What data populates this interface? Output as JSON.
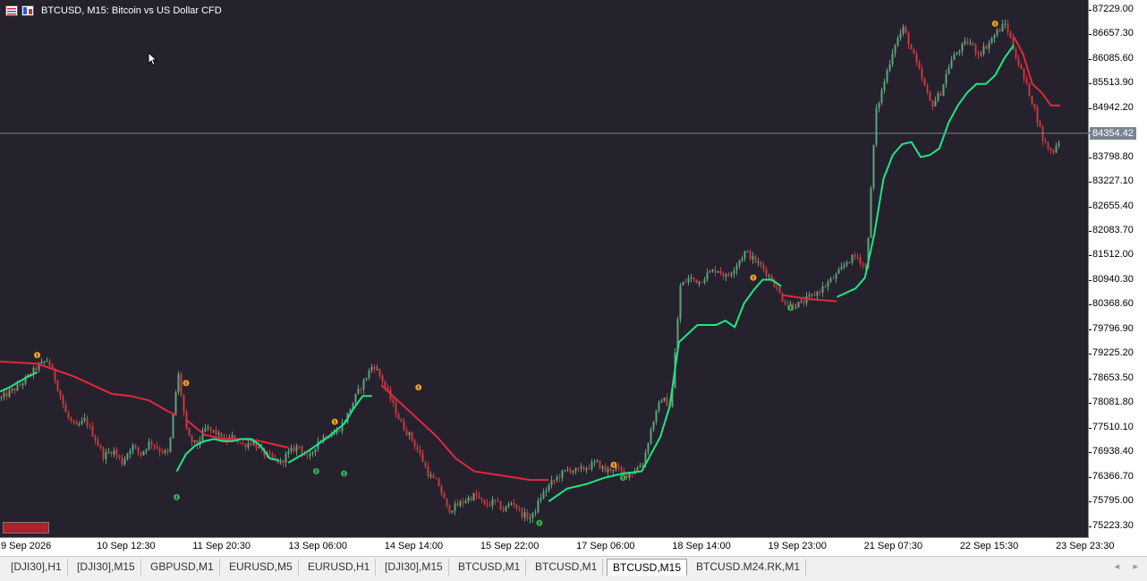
{
  "title": {
    "symbol": "BTCUSD, M15:",
    "description": "Bitcoin vs US Dollar CFD"
  },
  "icons": [
    "candles-grid-icon",
    "one-click-trading-icon"
  ],
  "price_axis": {
    "ticks": [
      "87229.00",
      "86657.30",
      "86085.60",
      "85513.90",
      "84942.20",
      "84370.50",
      "83798.80",
      "83227.10",
      "82655.40",
      "82083.70",
      "81512.00",
      "80940.30",
      "80368.60",
      "79796.90",
      "79225.20",
      "78653.50",
      "78081.80",
      "77510.10",
      "76938.40",
      "76366.70",
      "75795.00",
      "75223.30"
    ],
    "current_price": "84354.42"
  },
  "time_axis": {
    "labels": [
      "9 Sep 2026",
      "10 Sep 12:30",
      "11 Sep 20:30",
      "13 Sep 06:00",
      "14 Sep 14:00",
      "15 Sep 22:00",
      "17 Sep 06:00",
      "18 Sep 14:00",
      "19 Sep 23:00",
      "21 Sep 07:30",
      "22 Sep 15:30",
      "23 Sep 23:30"
    ]
  },
  "tabs": [
    {
      "label": "[DJI30],H1",
      "active": false
    },
    {
      "label": "[DJI30],M15",
      "active": false
    },
    {
      "label": "GBPUSD,M1",
      "active": false
    },
    {
      "label": "EURUSD,M5",
      "active": false
    },
    {
      "label": "EURUSD,H1",
      "active": false
    },
    {
      "label": "[DJI30],M15",
      "active": false
    },
    {
      "label": "BTCUSD,M1",
      "active": false
    },
    {
      "label": "BTCUSD,M1",
      "active": false
    },
    {
      "label": "BTCUSD,M15",
      "active": true
    },
    {
      "label": "BTCUSD.M24.RK,M1",
      "active": false
    }
  ],
  "tab_scroll": {
    "left": "◂",
    "right": "▸"
  },
  "colors": {
    "background": "#25222d",
    "bull_candle": "#5fa37a",
    "bear_candle": "#c9383f",
    "supertrend_up": "#1de782",
    "supertrend_down": "#e3283b",
    "sell_arrow": "#f0a020",
    "buy_arrow": "#2fae4f",
    "price_line": "#7a8491"
  },
  "chart_data": {
    "type": "candlestick",
    "symbol": "BTCUSD",
    "timeframe": "M15",
    "ylim": [
      74950,
      87450
    ],
    "close_path": [
      [
        0,
        78200
      ],
      [
        2,
        78500
      ],
      [
        4,
        78950
      ],
      [
        5,
        79100
      ],
      [
        6,
        78500
      ],
      [
        7,
        77800
      ],
      [
        8,
        77500
      ],
      [
        9,
        77700
      ],
      [
        10,
        77300
      ],
      [
        11,
        76850
      ],
      [
        12,
        77000
      ],
      [
        13,
        76700
      ],
      [
        14,
        77100
      ],
      [
        15,
        76900
      ],
      [
        16,
        77200
      ],
      [
        17,
        77000
      ],
      [
        18,
        76900
      ],
      [
        19,
        78800
      ],
      [
        20,
        77300
      ],
      [
        21,
        77100
      ],
      [
        22,
        77500
      ],
      [
        23,
        77400
      ],
      [
        24,
        77200
      ],
      [
        25,
        77300
      ],
      [
        26,
        77100
      ],
      [
        27,
        77200
      ],
      [
        28,
        76950
      ],
      [
        29,
        76800
      ],
      [
        30,
        76700
      ],
      [
        31,
        76950
      ],
      [
        32,
        77100
      ],
      [
        33,
        76750
      ],
      [
        34,
        77200
      ],
      [
        35,
        77350
      ],
      [
        36,
        77400
      ],
      [
        37,
        77700
      ],
      [
        38,
        78200
      ],
      [
        39,
        78600
      ],
      [
        40,
        79000
      ],
      [
        41,
        78600
      ],
      [
        42,
        78100
      ],
      [
        43,
        77600
      ],
      [
        44,
        77300
      ],
      [
        45,
        76900
      ],
      [
        46,
        76400
      ],
      [
        47,
        76200
      ],
      [
        48,
        75600
      ],
      [
        49,
        75700
      ],
      [
        50,
        75850
      ],
      [
        51,
        75950
      ],
      [
        52,
        75700
      ],
      [
        53,
        75800
      ],
      [
        54,
        75600
      ],
      [
        55,
        75800
      ],
      [
        56,
        75500
      ],
      [
        57,
        75400
      ],
      [
        58,
        75900
      ],
      [
        59,
        76200
      ],
      [
        60,
        76400
      ],
      [
        61,
        76550
      ],
      [
        62,
        76500
      ],
      [
        63,
        76600
      ],
      [
        64,
        76700
      ],
      [
        65,
        76500
      ],
      [
        66,
        76600
      ],
      [
        67,
        76400
      ],
      [
        68,
        76500
      ],
      [
        69,
        76700
      ],
      [
        70,
        77600
      ],
      [
        71,
        78200
      ],
      [
        72,
        78000
      ],
      [
        73,
        80800
      ],
      [
        74,
        81000
      ],
      [
        75,
        80900
      ],
      [
        76,
        81100
      ],
      [
        77,
        81200
      ],
      [
        78,
        81000
      ],
      [
        79,
        81300
      ],
      [
        80,
        81600
      ],
      [
        81,
        81400
      ],
      [
        82,
        81200
      ],
      [
        83,
        80900
      ],
      [
        84,
        80500
      ],
      [
        85,
        80350
      ],
      [
        86,
        80400
      ],
      [
        87,
        80550
      ],
      [
        88,
        80700
      ],
      [
        89,
        80900
      ],
      [
        90,
        81100
      ],
      [
        91,
        81400
      ],
      [
        92,
        81500
      ],
      [
        93,
        81200
      ],
      [
        94,
        84800
      ],
      [
        95,
        85600
      ],
      [
        96,
        86400
      ],
      [
        97,
        86800
      ],
      [
        98,
        86200
      ],
      [
        99,
        85600
      ],
      [
        100,
        85000
      ],
      [
        101,
        85300
      ],
      [
        102,
        86000
      ],
      [
        103,
        86300
      ],
      [
        104,
        86500
      ],
      [
        105,
        86200
      ],
      [
        106,
        86400
      ],
      [
        107,
        86700
      ],
      [
        108,
        86900
      ],
      [
        109,
        86200
      ],
      [
        110,
        85600
      ],
      [
        111,
        85000
      ],
      [
        112,
        84200
      ],
      [
        113,
        83900
      ],
      [
        114,
        84300
      ]
    ],
    "series": [
      {
        "name": "",
        "values": []
      }
    ],
    "supertrend": {
      "down_segments": [
        [
          [
            0,
            79050
          ],
          [
            4,
            79000
          ],
          [
            8,
            78700
          ],
          [
            10,
            78500
          ],
          [
            12,
            78300
          ],
          [
            14,
            78250
          ],
          [
            16,
            78150
          ],
          [
            18,
            77900
          ],
          [
            19,
            77800
          ]
        ],
        [
          [
            20,
            77700
          ],
          [
            22,
            77350
          ],
          [
            24,
            77250
          ],
          [
            26,
            77250
          ],
          [
            28,
            77200
          ],
          [
            30,
            77100
          ],
          [
            31,
            77050
          ]
        ],
        [
          [
            41,
            78500
          ],
          [
            43,
            78100
          ],
          [
            45,
            77700
          ],
          [
            47,
            77300
          ],
          [
            49,
            76800
          ],
          [
            51,
            76500
          ],
          [
            54,
            76400
          ],
          [
            57,
            76300
          ],
          [
            59,
            76300
          ]
        ],
        [
          [
            84,
            80600
          ],
          [
            87,
            80500
          ],
          [
            90,
            80450
          ]
        ],
        [
          [
            109,
            86600
          ],
          [
            110,
            86200
          ],
          [
            111,
            85500
          ],
          [
            112,
            85300
          ],
          [
            113,
            85000
          ],
          [
            114,
            85000
          ]
        ]
      ],
      "up_segments": [
        [
          [
            0,
            78350
          ],
          [
            1,
            78450
          ],
          [
            3,
            78700
          ],
          [
            4,
            78800
          ]
        ],
        [
          [
            19,
            76500
          ],
          [
            20,
            76900
          ],
          [
            21,
            77100
          ],
          [
            22,
            77200
          ],
          [
            23,
            77250
          ],
          [
            24,
            77200
          ],
          [
            25,
            77200
          ],
          [
            26,
            77250
          ],
          [
            27,
            77250
          ],
          [
            28,
            77100
          ],
          [
            29,
            76800
          ],
          [
            30,
            76750
          ]
        ],
        [
          [
            31,
            76700
          ],
          [
            33,
            76950
          ],
          [
            35,
            77250
          ],
          [
            37,
            77600
          ],
          [
            38,
            77950
          ],
          [
            39,
            78250
          ],
          [
            40,
            78250
          ]
        ],
        [
          [
            59,
            75800
          ],
          [
            61,
            76100
          ],
          [
            63,
            76200
          ],
          [
            65,
            76350
          ],
          [
            67,
            76450
          ],
          [
            69,
            76500
          ],
          [
            71,
            77300
          ],
          [
            72,
            78000
          ],
          [
            73,
            79500
          ],
          [
            75,
            79900
          ],
          [
            77,
            79900
          ],
          [
            78,
            80000
          ],
          [
            79,
            79850
          ],
          [
            80,
            80400
          ],
          [
            81,
            80700
          ],
          [
            82,
            80950
          ],
          [
            83,
            80950
          ],
          [
            84,
            80800
          ]
        ],
        [
          [
            90,
            80550
          ],
          [
            92,
            80750
          ],
          [
            93,
            81000
          ],
          [
            94,
            82000
          ],
          [
            95,
            83300
          ],
          [
            96,
            83850
          ],
          [
            97,
            84100
          ],
          [
            98,
            84150
          ],
          [
            99,
            83800
          ],
          [
            100,
            83850
          ],
          [
            101,
            84000
          ],
          [
            102,
            84600
          ],
          [
            103,
            85000
          ],
          [
            104,
            85300
          ],
          [
            105,
            85500
          ],
          [
            106,
            85500
          ],
          [
            107,
            85700
          ],
          [
            108,
            86100
          ],
          [
            109,
            86400
          ]
        ]
      ]
    },
    "signals": [
      {
        "type": "sell",
        "x": 4,
        "price": 79200
      },
      {
        "type": "sell",
        "x": 20,
        "price": 78550
      },
      {
        "type": "buy",
        "x": 19,
        "price": 75900
      },
      {
        "type": "sell",
        "x": 36,
        "price": 77650
      },
      {
        "type": "buy",
        "x": 34,
        "price": 76500
      },
      {
        "type": "buy",
        "x": 37,
        "price": 76450
      },
      {
        "type": "sell",
        "x": 45,
        "price": 78450
      },
      {
        "type": "buy",
        "x": 58,
        "price": 75300
      },
      {
        "type": "sell",
        "x": 66,
        "price": 76650
      },
      {
        "type": "buy",
        "x": 67,
        "price": 76350
      },
      {
        "type": "sell",
        "x": 81,
        "price": 81000
      },
      {
        "type": "buy",
        "x": 85,
        "price": 80300
      },
      {
        "type": "sell",
        "x": 107,
        "price": 86900
      }
    ]
  }
}
